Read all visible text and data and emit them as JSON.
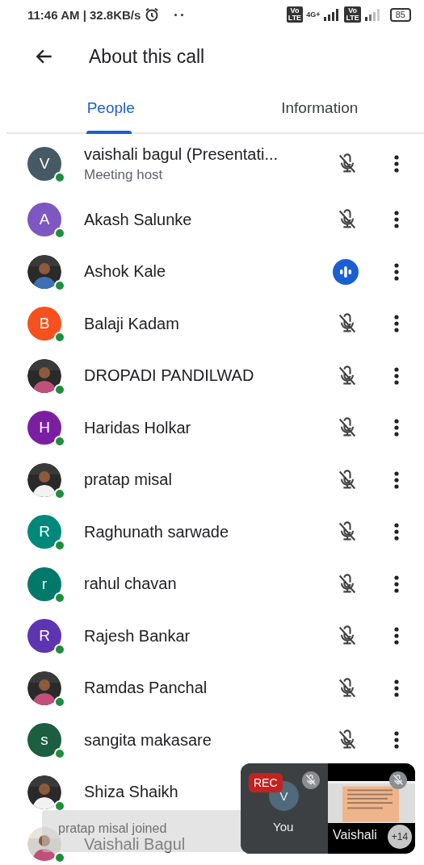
{
  "status_bar": {
    "time": "11:46 AM | 32.8KB/s",
    "sim_badges": [
      "Vo",
      "LTE",
      "Vo",
      "LTE"
    ],
    "network_type": "4G+",
    "battery": "85"
  },
  "header": {
    "title": "About this call"
  },
  "tabs": [
    {
      "label": "People",
      "selected": true
    },
    {
      "label": "Information",
      "selected": false
    }
  ],
  "participants": [
    {
      "name": "vaishali bagul (Presentati...",
      "subtitle": "Meeting host",
      "avatar": {
        "kind": "letter",
        "letter": "V",
        "color": "#455a64"
      },
      "muted": true
    },
    {
      "name": "Akash Salunke",
      "avatar": {
        "kind": "letter",
        "letter": "A",
        "color": "#7e57c2"
      },
      "muted": true
    },
    {
      "name": "Ashok Kale",
      "muted": false
    },
    {
      "name": "Balaji Kadam",
      "avatar": {
        "kind": "letter",
        "letter": "B",
        "color": "#f4511e"
      },
      "muted": true
    },
    {
      "name": "DROPADI PANDILWAD",
      "muted": true
    },
    {
      "name": "Haridas Holkar",
      "avatar": {
        "kind": "letter",
        "letter": "H",
        "color": "#7b1fa2"
      },
      "muted": true
    },
    {
      "name": "pratap misal",
      "muted": true
    },
    {
      "name": "Raghunath sarwade",
      "avatar": {
        "kind": "letter",
        "letter": "R",
        "color": "#00897b"
      },
      "muted": true
    },
    {
      "name": "rahul chavan",
      "avatar": {
        "kind": "letter",
        "letter": "r",
        "color": "#00796b"
      },
      "muted": true
    },
    {
      "name": "Rajesh Bankar",
      "avatar": {
        "kind": "letter",
        "letter": "R",
        "color": "#5e35b1"
      },
      "muted": true
    },
    {
      "name": "Ramdas Panchal",
      "muted": true
    },
    {
      "name": "sangita makasare",
      "avatar": {
        "kind": "letter",
        "letter": "s",
        "color": "#1b5e40"
      },
      "muted": true
    },
    {
      "name": "Shiza Shaikh"
    },
    {
      "name": "Vaishali Bagul"
    }
  ],
  "toast": {
    "text": "pratap misal joined"
  },
  "floating_tiles": {
    "self": {
      "rec": "REC",
      "letter": "V",
      "label": "You"
    },
    "presenter": {
      "label": "Vaishali"
    },
    "more_count": "+14"
  }
}
